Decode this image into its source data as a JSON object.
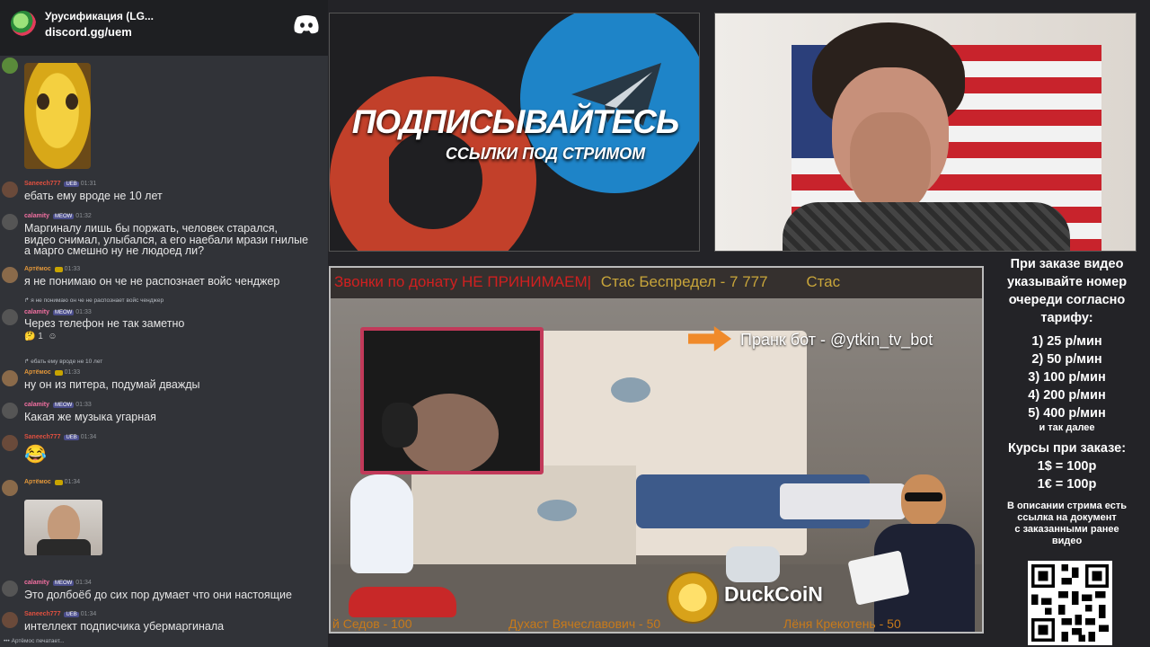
{
  "discord": {
    "server_name": "Урусификация (LG...",
    "invite": "discord.gg/uem",
    "typing": "Артёмос печатает..."
  },
  "messages": [
    {
      "user": "Saneech777",
      "badge": "UEB",
      "time": "01:31",
      "text": "ебать ему вроде не 10 лет"
    },
    {
      "user": "calamity",
      "badge": "MEOW",
      "time": "01:32",
      "text": "Маргиналу лишь бы поржать, человек старался,",
      "text2": "видео снимал, улыбался, а его наебали мрази гнилые",
      "text3": "а марго смешно ну не людоед ли?"
    },
    {
      "user": "Артёмос",
      "time": "01:33",
      "text": "я не понимаю он че не распознает войс ченджер"
    },
    {
      "reply": "я не понимаю он че не распознает войс ченджер",
      "user": "calamity",
      "badge": "MEOW",
      "time": "01:33",
      "text": "Через телефон не так заметно",
      "reaction": "1"
    },
    {
      "reply": "ебать ему вроде не 10 лет",
      "user": "Артёмос",
      "time": "01:33",
      "text": "ну он из питера, подумай дважды"
    },
    {
      "user": "calamity",
      "badge": "MEOW",
      "time": "01:33",
      "text": "Какая же музыка угарная"
    },
    {
      "user": "Saneech777",
      "badge": "UEB",
      "time": "01:34",
      "text": "😂"
    },
    {
      "user": "Артёмос",
      "time": "01:34",
      "text": ""
    },
    {
      "user": "calamity",
      "badge": "MEOW",
      "time": "01:34",
      "text": "Это долбоёб до сих пор думает что они настоящие"
    },
    {
      "user": "Saneech777",
      "badge": "UEB",
      "time": "01:34",
      "text": "интеллект подписчика убермаргинала"
    }
  ],
  "promo": {
    "title": "ПОДПИСЫВАЙТЕСЬ",
    "subtitle": "ССЫЛКИ ПОД СТРИМОМ"
  },
  "scene": {
    "ticker": "Звонки по донату НЕ ПРИНИМАЕМ|",
    "ticker_name": "Стас Беспредел - 7 777",
    "ticker_tail": "Стас",
    "prank_bot": "Пранк бот - @ytkin_tv_bot",
    "duckcoin": "DuckCoiN",
    "donor1": "й Седов - 100",
    "donor2": "Духаст Вячеславович - 50",
    "donor3": "Лёня Крекотень - 50"
  },
  "info": {
    "line1": "При заказе видео",
    "line2": "указывайте номер",
    "line3": "очереди согласно",
    "line4": "тарифу:",
    "tariffs": [
      "1) 25 р/мин",
      "2) 50 р/мин",
      "3) 100 р/мин",
      "4) 200 р/мин",
      "5) 400 р/мин"
    ],
    "etc": "и так далее",
    "rates_title": "Курсы при заказе:",
    "rate1": "1$ = 100р",
    "rate2": "1€ = 100р",
    "desc1": "В описании стрима есть",
    "desc2": "ссылка на документ",
    "desc3": "с заказанными ранее",
    "desc4": "видео"
  },
  "colors": {
    "discord_bg": "#313338",
    "telegram": "#1e84c8",
    "patreon": "#c2402a",
    "ticker_red": "#d02020"
  }
}
